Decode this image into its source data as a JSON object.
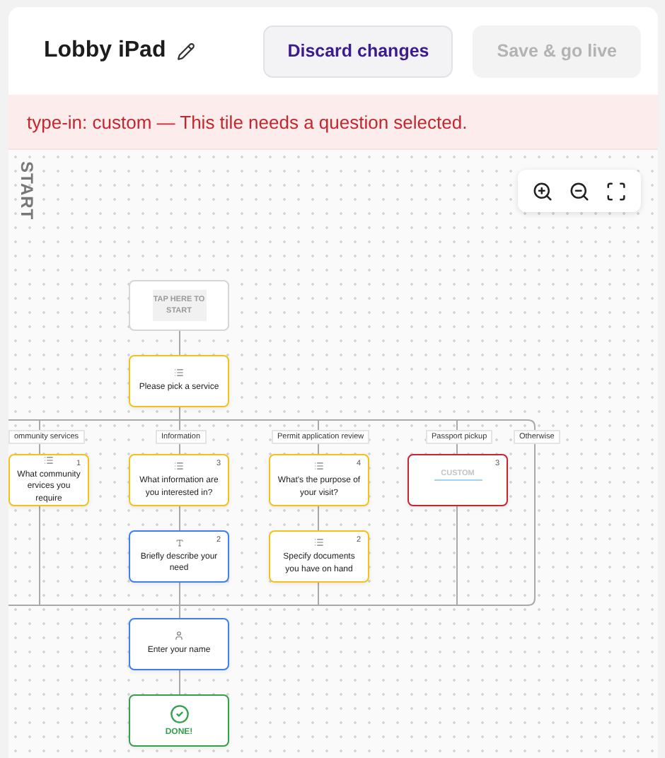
{
  "header": {
    "title": "Lobby iPad",
    "buttons": [
      {
        "label": "Discard changes",
        "disabled": false
      },
      {
        "label": "Save & go live",
        "disabled": true
      }
    ]
  },
  "error_banner": "type-in: custom — This tile needs a question selected.",
  "canvas": {
    "lane_label": "START",
    "start_tile": "TAP HERE TO START",
    "branches": [
      "ommunity services",
      "Information",
      "Permit application review",
      "Passport pickup",
      "Otherwise"
    ],
    "nodes": [
      {
        "kind": "choice",
        "text": "Please pick a service",
        "color": "#f2c21b"
      },
      {
        "kind": "choice",
        "text": "What community\nervices you require",
        "badge": "1",
        "color": "#f2c21b"
      },
      {
        "kind": "choice",
        "text": "What information are you interested in?",
        "badge": "3",
        "color": "#f2c21b"
      },
      {
        "kind": "choice",
        "text": "What's the purpose of your visit?",
        "badge": "4",
        "color": "#f2c21b"
      },
      {
        "kind": "custom",
        "placeholder": "CUSTOM",
        "badge": "3",
        "color": "#c9252f"
      },
      {
        "kind": "text",
        "text": "Briefly describe your need",
        "badge": "2",
        "color": "#3b7ff0"
      },
      {
        "kind": "choice",
        "text": "Specify documents you have on hand",
        "badge": "2",
        "color": "#f2c21b"
      },
      {
        "kind": "person",
        "text": "Enter your name",
        "color": "#3b7ff0"
      },
      {
        "kind": "done",
        "text": "DONE!",
        "color": "#35a04a"
      }
    ]
  }
}
